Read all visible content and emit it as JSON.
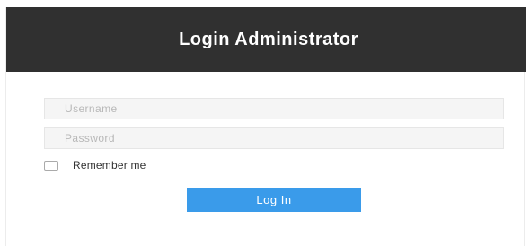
{
  "header": {
    "title": "Login Administrator"
  },
  "form": {
    "username_placeholder": "Username",
    "password_placeholder": "Password",
    "remember_label": "Remember me",
    "submit_label": "Log In"
  },
  "colors": {
    "header_bg": "#303030",
    "button_bg": "#3a9bea"
  }
}
